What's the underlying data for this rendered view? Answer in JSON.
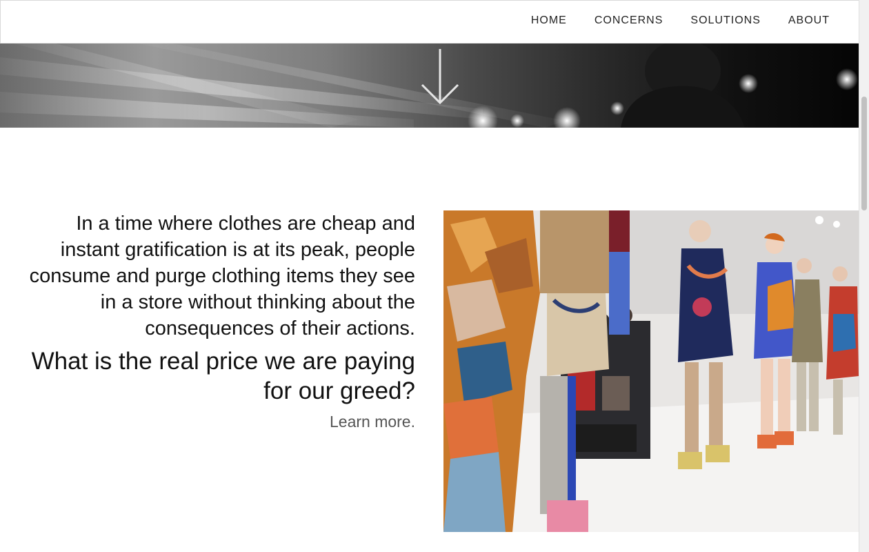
{
  "nav": {
    "items": [
      {
        "label": "HOME"
      },
      {
        "label": "CONCERNS"
      },
      {
        "label": "SOLUTIONS"
      },
      {
        "label": "ABOUT"
      }
    ]
  },
  "hero": {
    "icon": "arrow-down-icon"
  },
  "content": {
    "intro": "In a time where clothes are cheap and instant gratification is at its peak, people consume and purge clothing items they see in a store without thinking about the consequences of their actions.",
    "question": "What is the real price we are paying for our greed?",
    "learn_more": "Learn more."
  },
  "photo": {
    "subject": "runway-fashion-show-photo"
  },
  "colors": {
    "text": "#111111",
    "muted": "#555555",
    "nav_text": "#222222",
    "background": "#ffffff"
  }
}
